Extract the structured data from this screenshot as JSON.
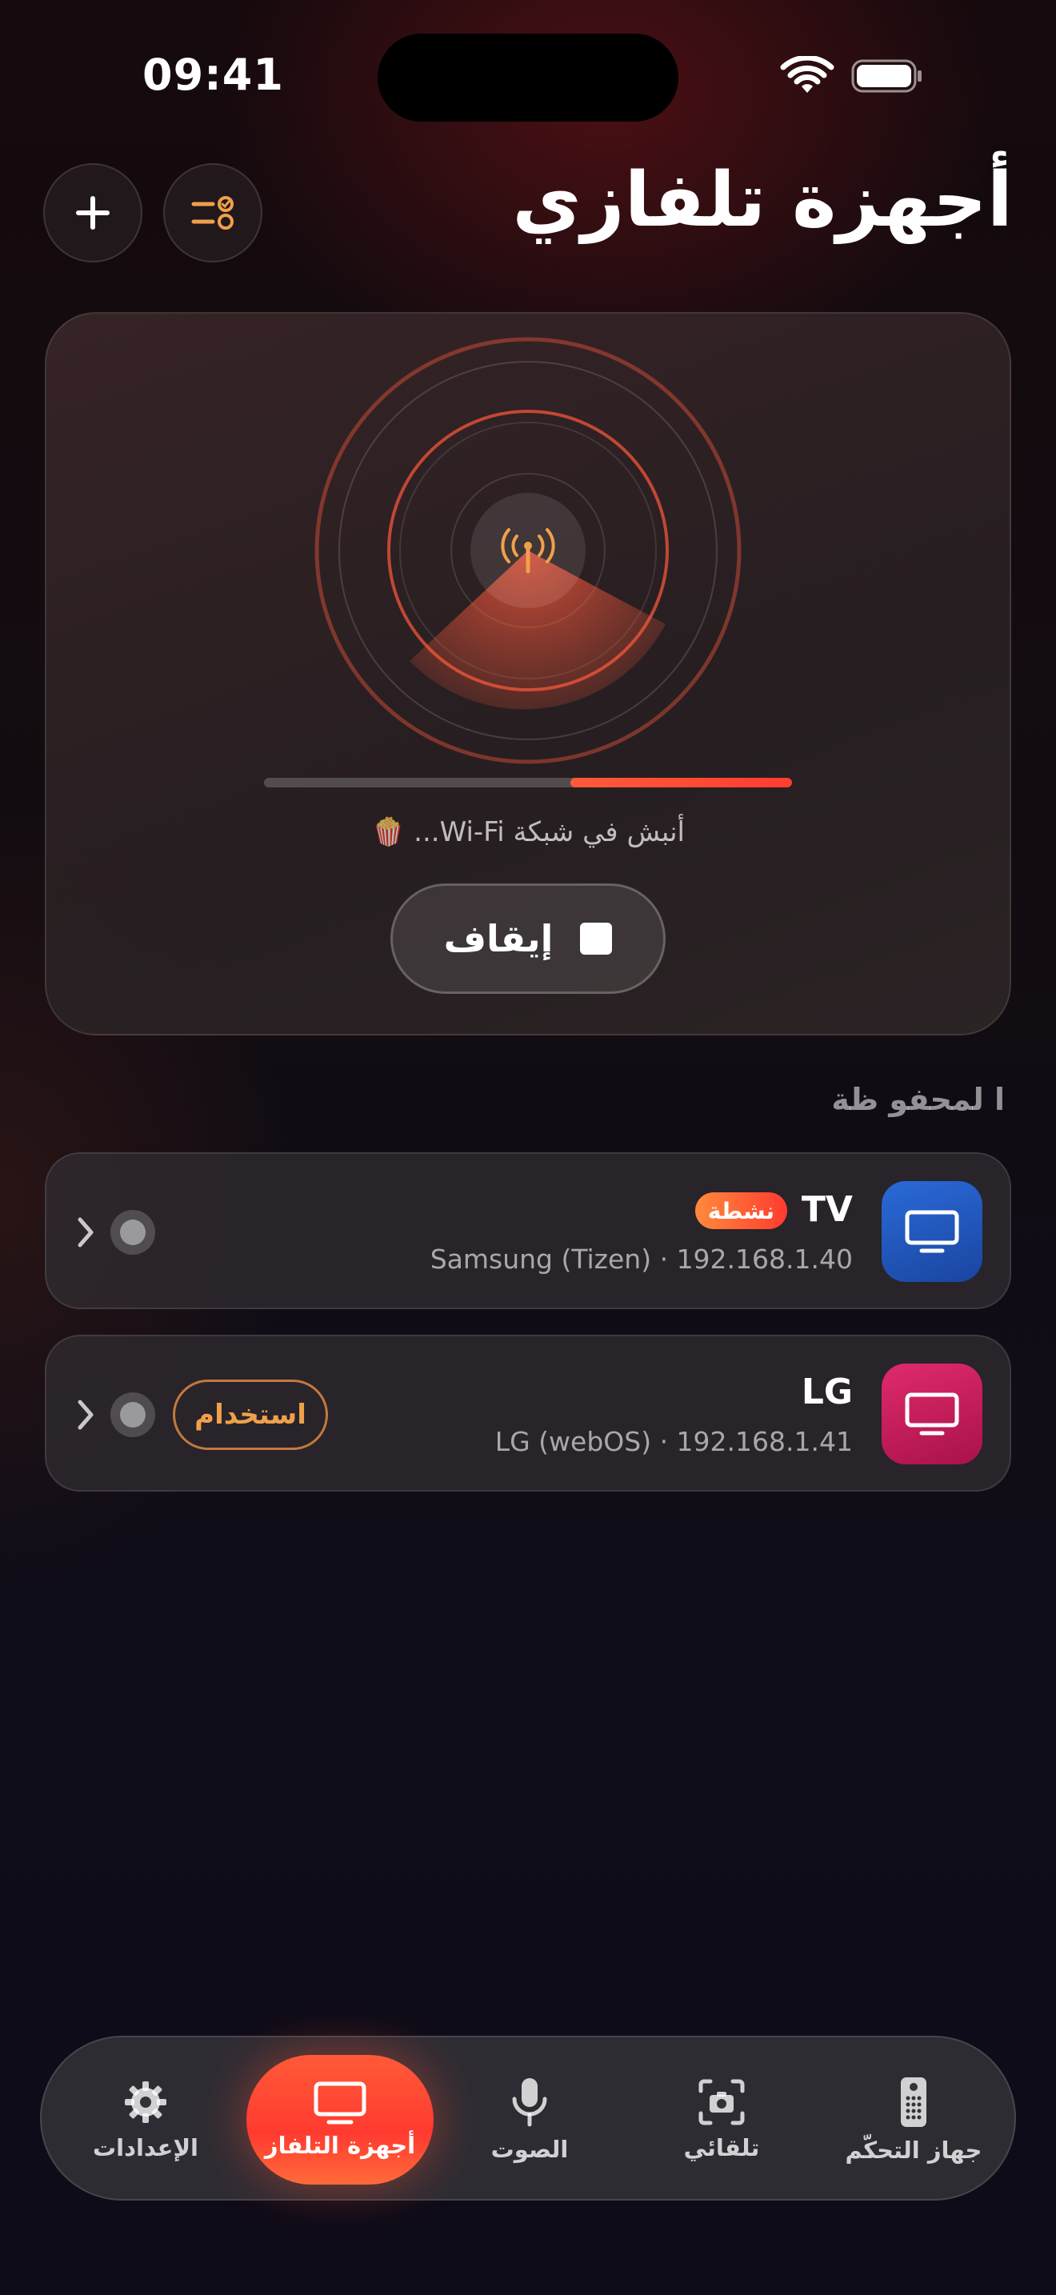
{
  "status_bar": {
    "time": "09:41"
  },
  "header": {
    "title": "أجهزة تلفازي"
  },
  "scanner": {
    "progress": 0.42,
    "status_text": "أنبش في شبكة Wi-Fi... 🍿",
    "stop_label": "إيقاف"
  },
  "saved": {
    "section_title": "ا لمحفو ظة",
    "devices": [
      {
        "name": "TV",
        "badge": "نشطة",
        "meta": "Samsung (Tizen) · 192.168.1.40",
        "icon_color": "#1f54b8"
      },
      {
        "name": "LG",
        "use_label": "استخدام",
        "meta": "LG (webOS) · 192.168.1.41",
        "icon_color": "#c4185a"
      }
    ]
  },
  "tab_bar": {
    "items": [
      {
        "label": "الإعدادات",
        "icon": "gear-icon"
      },
      {
        "label": "أجهزة التلفاز",
        "icon": "tv-icon",
        "active": true
      },
      {
        "label": "الصوت",
        "icon": "microphone-icon"
      },
      {
        "label": "تلقائي",
        "icon": "camera-scan-icon"
      },
      {
        "label": "جهاز التحكّم",
        "icon": "remote-icon"
      }
    ]
  },
  "colors": {
    "accent": "#ff4a32",
    "accent_orange": "#f0a04a"
  }
}
